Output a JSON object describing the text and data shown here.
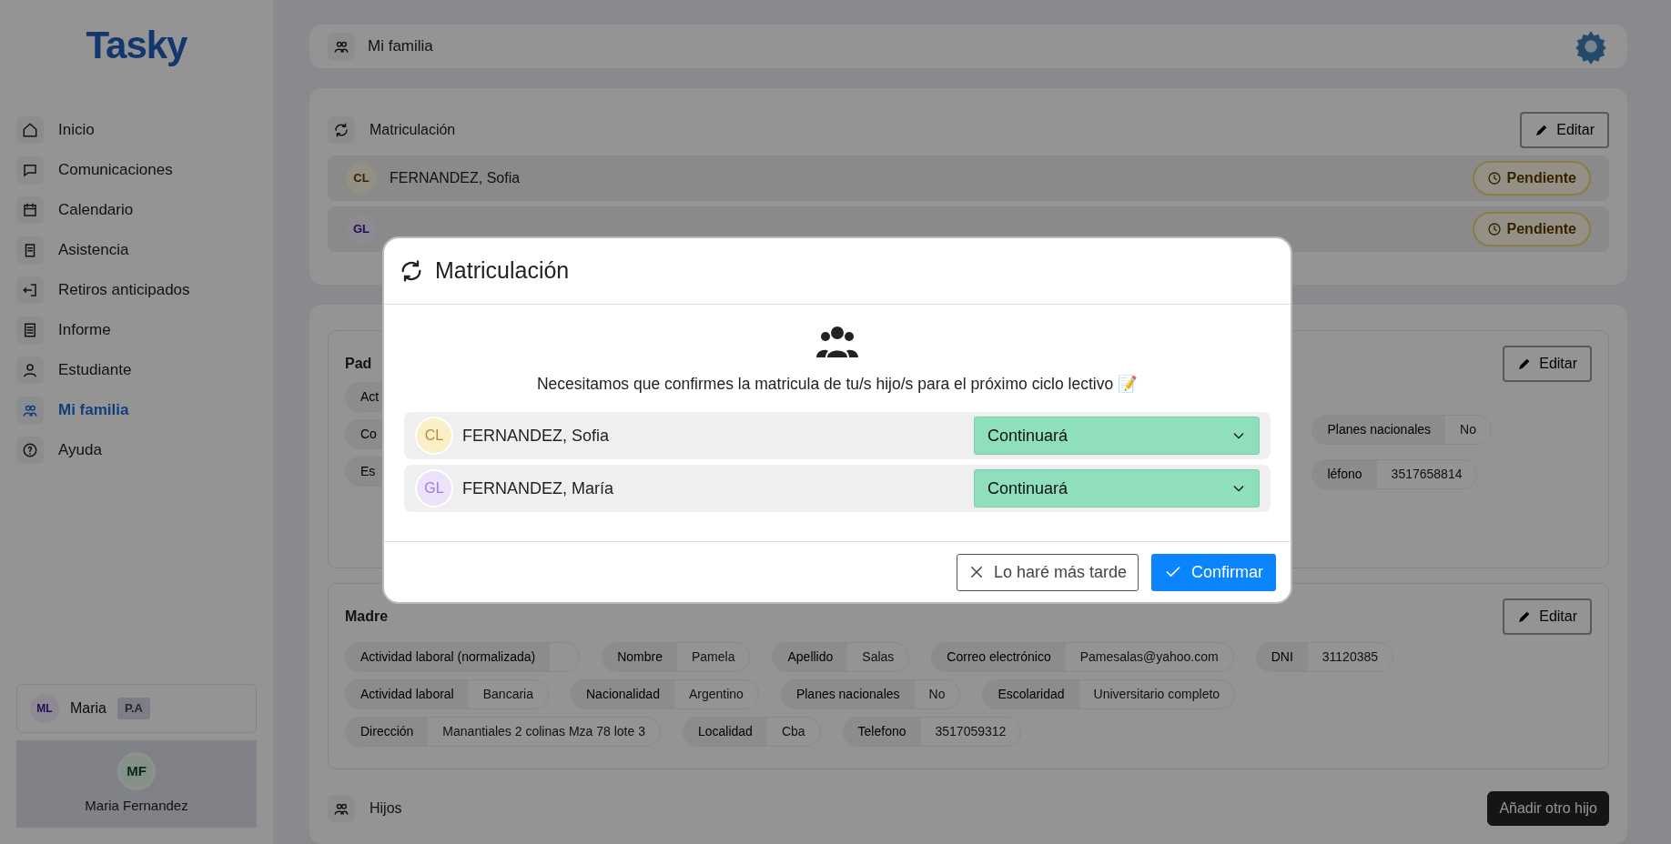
{
  "sidebar": {
    "logo": "Tasky",
    "items": [
      {
        "label": "Inicio",
        "selected": false
      },
      {
        "label": "Comunicaciones",
        "selected": false
      },
      {
        "label": "Calendario",
        "selected": false
      },
      {
        "label": "Asistencia",
        "selected": false
      },
      {
        "label": "Retiros anticipados",
        "selected": false
      },
      {
        "label": "Informe",
        "selected": false
      },
      {
        "label": "Estudiante",
        "selected": false
      },
      {
        "label": "Mi familia",
        "selected": true
      },
      {
        "label": "Ayuda",
        "selected": false
      }
    ],
    "account": {
      "initials": "ML",
      "name": "Maria",
      "tag": "P.A"
    },
    "profile": {
      "initials": "MF",
      "name": "Maria Fernandez"
    }
  },
  "header": {
    "title": "Mi familia"
  },
  "enrollment_card": {
    "title": "Matriculación",
    "edit_button": "Editar",
    "students": [
      {
        "initials": "CL",
        "name": "FERNANDEZ, Sofia",
        "status": "Pendiente"
      },
      {
        "initials": "GL",
        "status": "Pendiente"
      }
    ]
  },
  "father_card": {
    "title": "Pad",
    "edit_button": "Editar",
    "left_fields": [
      "Act",
      "Co",
      "Es"
    ],
    "right_rows": [
      [
        {
          "label": "Planes nacionales",
          "value": "No"
        }
      ],
      [
        {
          "label": "léfono",
          "value": "3517658814"
        }
      ]
    ]
  },
  "mother_card": {
    "title": "Madre",
    "edit_button": "Editar",
    "rows": [
      [
        {
          "label": "Actividad laboral (normalizada)"
        },
        {
          "label": "Nombre",
          "value": "Pamela"
        },
        {
          "label": "Apellido",
          "value": "Salas"
        },
        {
          "label": "Correo electrónico",
          "value": "Pamesalas@yahoo.com"
        },
        {
          "label": "DNI",
          "value": "31120385"
        }
      ],
      [
        {
          "label": "Actividad laboral",
          "value": "Bancaria"
        },
        {
          "label": "Nacionalidad",
          "value": "Argentino"
        },
        {
          "label": "Planes nacionales",
          "value": "No"
        },
        {
          "label": "Escolaridad",
          "value": "Universitario completo"
        }
      ],
      [
        {
          "label": "Dirección",
          "value": "Manantiales 2 colinas Mza 78 lote 3"
        },
        {
          "label": "Localidad",
          "value": "Cba"
        },
        {
          "label": "Telefono",
          "value": "3517059312"
        }
      ]
    ]
  },
  "children_section": {
    "title": "Hijos",
    "add_button": "Añadir otro hijo"
  },
  "modal": {
    "title": "Matriculación",
    "message": "Necesitamos que confirmes la matricula de tu/s hijo/s para el próximo ciclo lectivo 📝",
    "students": [
      {
        "initials": "CL",
        "name": "FERNANDEZ, Sofia",
        "color": "#fbefc8",
        "status": "Continuará"
      },
      {
        "initials": "GL",
        "name": "FERNANDEZ, María",
        "color": "#ece3fb",
        "status": "Continuará"
      }
    ],
    "buttons": [
      {
        "label": "Lo haré más tarde",
        "kind": "secondary"
      },
      {
        "label": "Confirmar",
        "kind": "primary"
      }
    ]
  }
}
